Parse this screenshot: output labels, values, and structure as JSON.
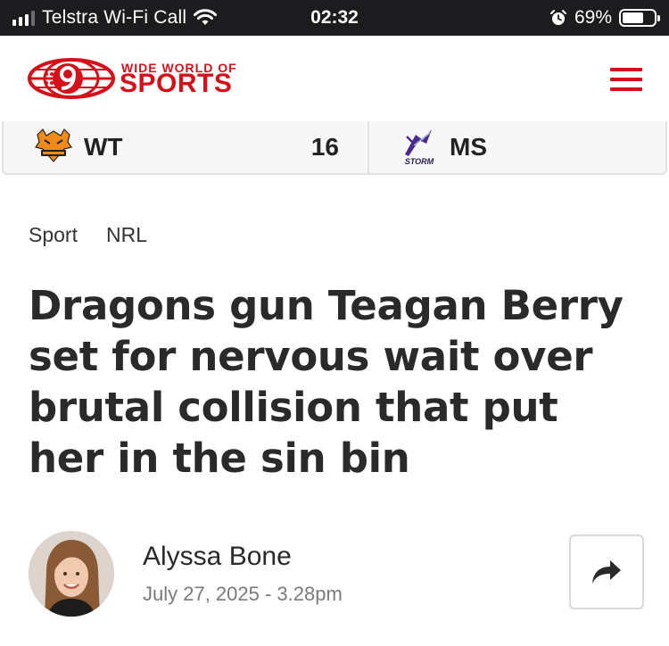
{
  "status_bar": {
    "carrier": "Telstra Wi-Fi Call",
    "time": "02:32",
    "battery_percent": "69%",
    "battery_level": 0.69,
    "icons": [
      "signal-icon",
      "wifi-icon",
      "alarm-icon",
      "battery-icon"
    ]
  },
  "header": {
    "logo_line1": "WIDE WORLD OF",
    "logo_line2": "SPORTS",
    "brand_color": "#d4111b",
    "menu_icon": "hamburger-menu-icon"
  },
  "score_bar": {
    "home": {
      "code": "WT",
      "score": "16",
      "logo": "wests-tigers-logo"
    },
    "away": {
      "code": "MS",
      "logo": "melbourne-storm-logo",
      "logo_text": "STORM"
    }
  },
  "article": {
    "breadcrumb": [
      "Sport",
      "NRL"
    ],
    "headline": "Dragons gun Teagan Berry set for nervous wait over brutal collision that put her in the sin bin",
    "author": "Alyssa Bone",
    "date": "July 27, 2025 - 3.28pm",
    "share_icon": "share-arrow-icon"
  }
}
